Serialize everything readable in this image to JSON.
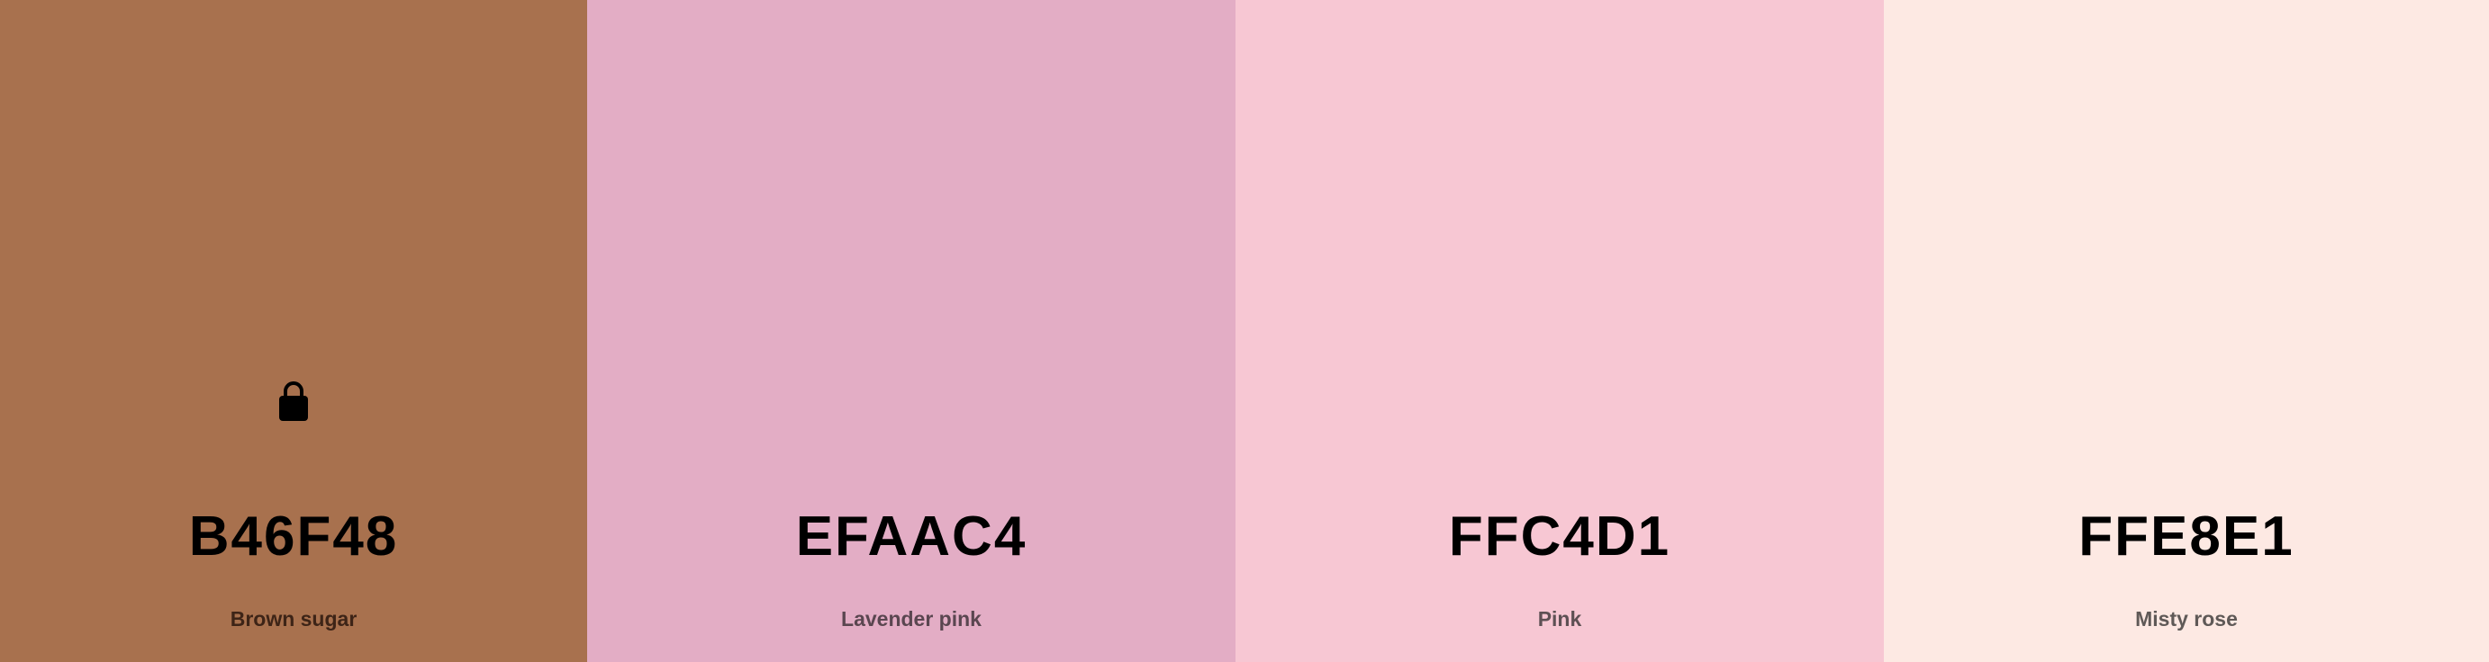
{
  "palette": {
    "swatches": [
      {
        "hex": "B46F48",
        "name": "Brown sugar",
        "color": "#A8714E",
        "name_color": "#3d2417",
        "locked": true
      },
      {
        "hex": "EFAAC4",
        "name": "Lavender pink",
        "color": "#E3ADC5",
        "name_color": "#5a4650",
        "locked": false
      },
      {
        "hex": "FFC4D1",
        "name": "Pink",
        "color": "#F7C7D3",
        "name_color": "#5e5054",
        "locked": false
      },
      {
        "hex": "FFE8E1",
        "name": "Misty rose",
        "color": "#FDE9E3",
        "name_color": "#5f5957",
        "locked": false
      }
    ],
    "lock_icon": "lock-icon"
  }
}
